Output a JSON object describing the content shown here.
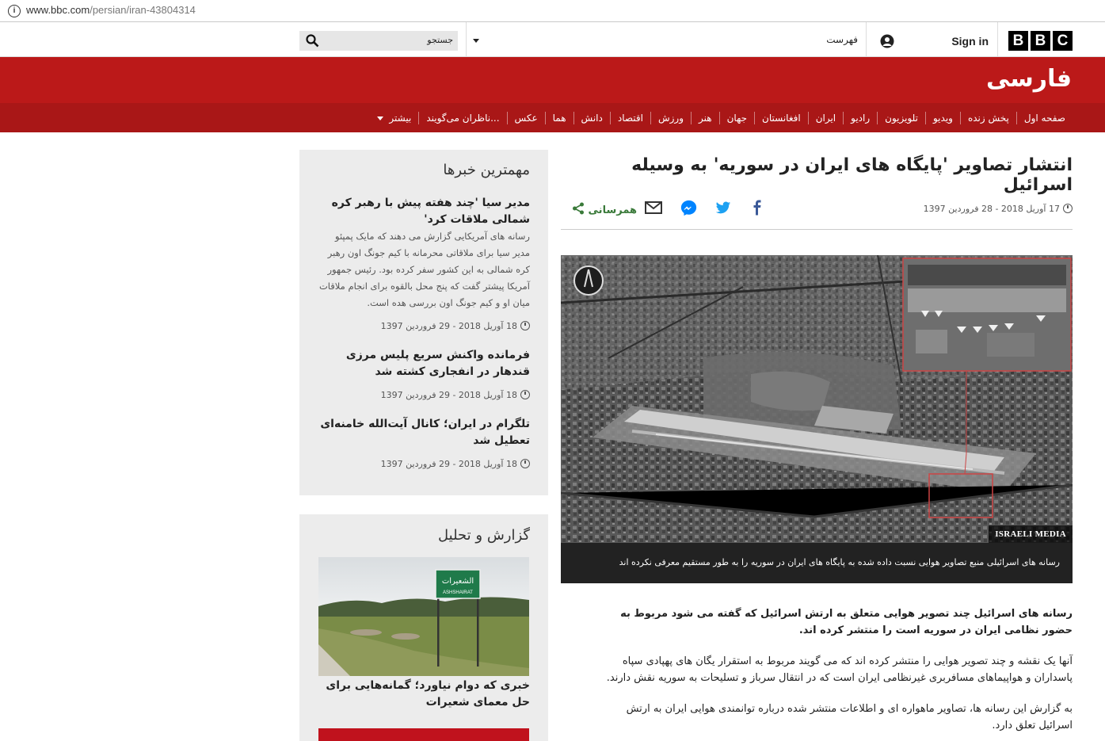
{
  "browser": {
    "url_host": "www.bbc.com",
    "url_path": "/persian/iran-43804314"
  },
  "header": {
    "logo_letters": [
      "B",
      "B",
      "C"
    ],
    "sign_in": "Sign in",
    "menu_label": "فهرست",
    "search_placeholder": "جستجو"
  },
  "brand": {
    "name": "فارسی",
    "accent": "#bb1919",
    "nav_bg": "#a91717"
  },
  "nav": {
    "items": [
      "صفحه اول",
      "پخش زنده",
      "ویدیو",
      "تلویزیون",
      "رادیو",
      "ایران",
      "افغانستان",
      "جهان",
      "هنر",
      "ورزش",
      "اقتصاد",
      "دانش",
      "هما",
      "عکس",
      "ناظران می‌گویند...",
      "بیشتر"
    ]
  },
  "article": {
    "headline": "انتشار تصاویر 'پایگاه های ایران در سوریه' به وسیله اسرائیل",
    "date": "17 آوریل 2018 - 28 فروردین 1397",
    "share_label": "همرسانی",
    "share_icons": [
      "facebook-icon",
      "twitter-icon",
      "messenger-icon",
      "email-icon"
    ],
    "image_credit": "ISRAELI MEDIA",
    "image_caption": "رسانه های اسرائیلی منبع تصاویر هوایی نسبت داده شده به پایگاه های ایران در سوریه را به طور مستقیم معرفی نکرده اند",
    "paragraphs": [
      "رسانه های اسرائیل چند تصویر هوایی متعلق به ارتش اسرائیل که گفته می شود مربوط به حضور نظامی ایران در سوریه است را منتشر کرده اند.",
      "آنها یک نقشه و چند تصویر هوایی را منتشر کرده اند که می گویند مربوط به استقرار یگان های پهپادی سپاه پاسداران و هواپیماهای مسافربری غیرنظامی ایران است که در انتقال سرباز و تسلیحات به سوریه نقش دارند.",
      "به گزارش این رسانه ها، تصاویر ماهواره ای و اطلاعات منتشر شده درباره توانمندی هوایی ایران به ارتش اسرائیل تعلق دارد."
    ]
  },
  "top_stories": {
    "title": "مهمترین خبرها",
    "items": [
      {
        "title": "مدیر سیا 'چند هفته پیش با رهبر کره شمالی ملاقات کرد'",
        "summary": "رسانه های آمریکایی گزارش می دهند که مایک پمپئو مدیر سیا برای ملاقاتی محرمانه با کیم جونگ اون رهبر کره شمالی به این کشور سفر کرده بود. رئیس جمهور آمریکا پیشتر گفت که پنج محل بالقوه برای انجام ملاقات میان او و کیم جونگ اون بررسی هده است.",
        "date": "18 آوریل 2018 - 29 فروردین 1397"
      },
      {
        "title": "فرمانده واکنش سریع پلیس مرزی قندهار در انفجاری کشته شد",
        "date": "18 آوریل 2018 - 29 فروردین 1397"
      },
      {
        "title": "تلگرام در ایران؛ کانال آیت‌الله خامنه‌ای تعطیل شد",
        "date": "18 آوریل 2018 - 29 فروردین 1397"
      }
    ]
  },
  "features": {
    "title": "گزارش و تحلیل",
    "items": [
      {
        "title": "خبری که دوام نیاورد؛ گمانه‌هایی برای حل معمای شعیرات",
        "sign_text_ar": "الشعيرات",
        "sign_text_en": "ASHSHAIRAT"
      }
    ]
  }
}
